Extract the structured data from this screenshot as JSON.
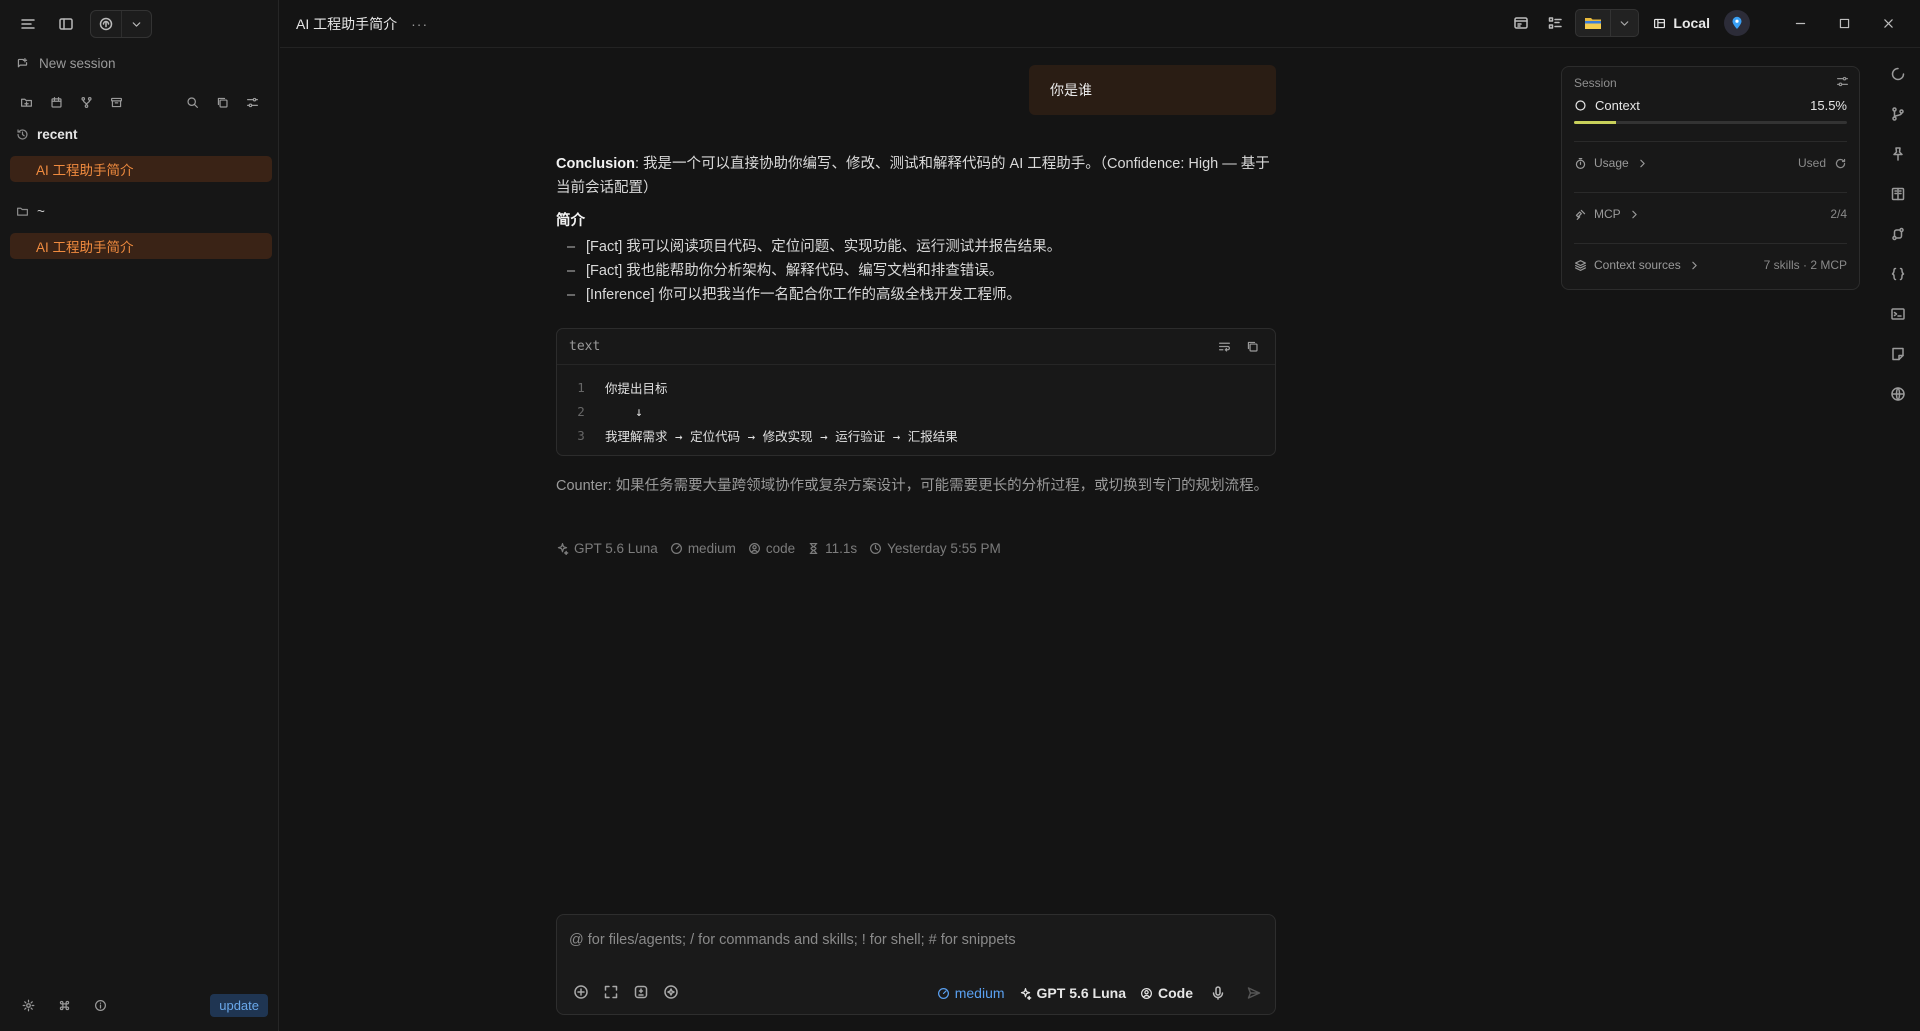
{
  "app": {
    "session_title": "AI 工程助手简介",
    "more": "···"
  },
  "sidebar": {
    "new_session": "New session",
    "recent_label": "recent",
    "recent_item": "AI 工程助手简介",
    "home_label": "~",
    "home_item": "AI 工程助手简介",
    "update_label": "update"
  },
  "topbar": {
    "local_label": "Local"
  },
  "chat": {
    "user_message": "你是谁",
    "answer": {
      "conclusion_label": "Conclusion",
      "conclusion_text": ": 我是一个可以直接协助你编写、修改、测试和解释代码的 AI 工程助手。（Confidence: High — 基于当前会话配置）",
      "section_title": "简介",
      "bullets": [
        "[Fact] 我可以阅读项目代码、定位问题、实现功能、运行测试并报告结果。",
        "[Fact] 我也能帮助你分析架构、解释代码、编写文档和排查错误。",
        "[Inference] 你可以把我当作一名配合你工作的高级全栈开发工程师。"
      ]
    },
    "code_block": {
      "lang": "text",
      "lines": [
        {
          "n": "1",
          "text": "你提出目标"
        },
        {
          "n": "2",
          "text": "    ↓"
        },
        {
          "n": "3",
          "text": "我理解需求 → 定位代码 → 修改实现 → 运行验证 → 汇报结果"
        }
      ]
    },
    "counter": "Counter: 如果任务需要大量跨领域协作或复杂方案设计，可能需要更长的分析过程，或切换到专门的规划流程。",
    "meta": {
      "model": "GPT 5.6 Luna",
      "effort": "medium",
      "mode": "code",
      "duration": "11.1s",
      "time": "Yesterday 5:55 PM"
    }
  },
  "composer": {
    "placeholder": "@ for files/agents; / for commands and skills; ! for shell; # for snippets",
    "effort": "medium",
    "model": "GPT 5.6 Luna",
    "mode": "Code"
  },
  "panel": {
    "header": "Session",
    "context_label": "Context",
    "context_value": "15.5%",
    "context_fraction": 0.155,
    "usage_label": "Usage",
    "usage_value": "Used",
    "mcp_label": "MCP",
    "mcp_value": "2/4",
    "sources_label": "Context sources",
    "sources_value": "7 skills · 2 MCP"
  },
  "colors": {
    "accent": "#f08b3f",
    "selection_bg": "#3a2316",
    "link_blue": "#5aa0f0",
    "progress": "#c8d05a"
  }
}
